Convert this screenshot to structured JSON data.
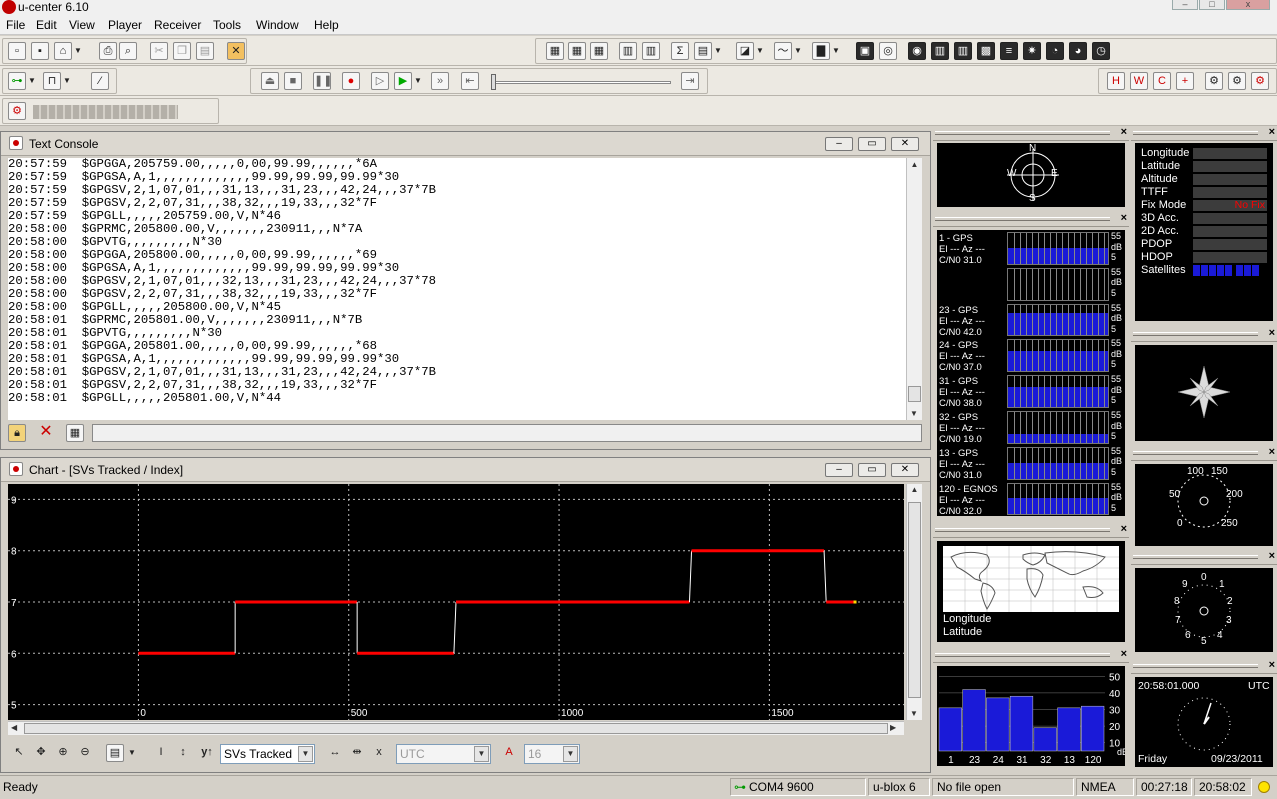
{
  "window": {
    "title": "u-center 6.10"
  },
  "menu": [
    "File",
    "Edit",
    "View",
    "Player",
    "Receiver",
    "Tools",
    "Window",
    "Help"
  ],
  "text_console": {
    "title": "Text Console",
    "lines": [
      "20:57:59  $GPGGA,205759.00,,,,,0,00,99.99,,,,,,*6A",
      "20:57:59  $GPGSA,A,1,,,,,,,,,,,,,99.99,99.99,99.99*30",
      "20:57:59  $GPGSV,2,1,07,01,,,31,13,,,31,23,,,42,24,,,37*7B",
      "20:57:59  $GPGSV,2,2,07,31,,,38,32,,,19,33,,,32*7F",
      "20:57:59  $GPGLL,,,,,205759.00,V,N*46",
      "20:58:00  $GPRMC,205800.00,V,,,,,,,230911,,,N*7A",
      "20:58:00  $GPVTG,,,,,,,,,N*30",
      "20:58:00  $GPGGA,205800.00,,,,,0,00,99.99,,,,,,*69",
      "20:58:00  $GPGSA,A,1,,,,,,,,,,,,,99.99,99.99,99.99*30",
      "20:58:00  $GPGSV,2,1,07,01,,,32,13,,,31,23,,,42,24,,,37*78",
      "20:58:00  $GPGSV,2,2,07,31,,,38,32,,,19,33,,,32*7F",
      "20:58:00  $GPGLL,,,,,205800.00,V,N*45",
      "20:58:01  $GPRMC,205801.00,V,,,,,,,230911,,,N*7B",
      "20:58:01  $GPVTG,,,,,,,,,N*30",
      "20:58:01  $GPGGA,205801.00,,,,,0,00,99.99,,,,,,*68",
      "20:58:01  $GPGSA,A,1,,,,,,,,,,,,,99.99,99.99,99.99*30",
      "20:58:01  $GPGSV,2,1,07,01,,,31,13,,,31,23,,,42,24,,,37*7B",
      "20:58:01  $GPGSV,2,2,07,31,,,38,32,,,19,33,,,32*7F",
      "20:58:01  $GPGLL,,,,,205801.00,V,N*44"
    ],
    "command_input": ""
  },
  "chart_panel": {
    "title": "Chart - [SVs Tracked / Index]",
    "series_select": "SVs Tracked",
    "time_select": "UTC",
    "size_select": "16"
  },
  "chart_data": {
    "type": "line",
    "title": "",
    "xlabel": "",
    "ylabel": "",
    "xlim": [
      -310,
      1820
    ],
    "ylim": [
      4.7,
      9.3
    ],
    "xticks": [
      0,
      500,
      1000,
      1500
    ],
    "yticks": [
      5,
      6,
      7,
      8,
      9
    ],
    "grid": true,
    "series": [
      {
        "color": "#ff0000",
        "points": [
          [
            0,
            6
          ],
          [
            230,
            6
          ],
          [
            230,
            7
          ],
          [
            520,
            7
          ],
          [
            520,
            6
          ],
          [
            750,
            6
          ],
          [
            755,
            7
          ],
          [
            1310,
            7
          ],
          [
            1315,
            8
          ],
          [
            1630,
            8
          ],
          [
            1635,
            7
          ],
          [
            1700,
            7
          ]
        ]
      }
    ],
    "end_marker_color": "#ffd700"
  },
  "sky_view": {
    "north": "N",
    "south": "S",
    "east": "E",
    "west": "W"
  },
  "satellites": [
    {
      "name": "1 - GPS",
      "el_az": "El --- Az ---",
      "cn0": "C/N0 31.0",
      "level": 31
    },
    {
      "name": "",
      "el_az": "",
      "cn0": "",
      "level": 0
    },
    {
      "name": "23 - GPS",
      "el_az": "El --- Az ---",
      "cn0": "C/N0 42.0",
      "level": 42
    },
    {
      "name": "24 - GPS",
      "el_az": "El --- Az ---",
      "cn0": "C/N0 37.0",
      "level": 37
    },
    {
      "name": "31 - GPS",
      "el_az": "El --- Az ---",
      "cn0": "C/N0 38.0",
      "level": 38
    },
    {
      "name": "32 - GPS",
      "el_az": "El --- Az ---",
      "cn0": "C/N0 19.0",
      "level": 19
    },
    {
      "name": "13 - GPS",
      "el_az": "El --- Az ---",
      "cn0": "C/N0 31.0",
      "level": 31
    },
    {
      "name": "120 - EGNOS",
      "el_az": "El --- Az ---",
      "cn0": "C/N0 32.0",
      "level": 32
    }
  ],
  "sat_scale": {
    "top": "55",
    "unit": "dB",
    "bottom": "5"
  },
  "navigation": {
    "labels": [
      "Longitude",
      "Latitude",
      "Altitude",
      "TTFF",
      "Fix Mode",
      "3D Acc.",
      "2D Acc.",
      "PDOP",
      "HDOP",
      "Satellites"
    ],
    "fix_mode_value": "No Fix"
  },
  "world_map": {
    "lon_label": "Longitude",
    "lat_label": "Latitude"
  },
  "speedometer": {
    "labels": [
      "100",
      "150",
      "50",
      "200",
      "0",
      "250"
    ]
  },
  "altimeter": {
    "labels": [
      "0",
      "9",
      "1",
      "8",
      "2",
      "7",
      "3",
      "6",
      "5",
      "4"
    ]
  },
  "cn0_histogram": {
    "bars": [
      {
        "label": "1",
        "value": 31
      },
      {
        "label": "23",
        "value": 42
      },
      {
        "label": "24",
        "value": 37
      },
      {
        "label": "31",
        "value": 38
      },
      {
        "label": "32",
        "value": 19
      },
      {
        "label": "13",
        "value": 31
      },
      {
        "label": "120",
        "value": 32
      }
    ],
    "ticks": [
      "50",
      "40",
      "30",
      "20",
      "10"
    ],
    "unit": "dB"
  },
  "clock": {
    "time": "20:58:01.000",
    "zone": "UTC",
    "day": "Friday",
    "date": "09/23/2011"
  },
  "status": {
    "ready": "Ready",
    "port": "COM4 9600",
    "receiver": "u-blox 6",
    "file": "No file open",
    "protocol": "NMEA",
    "elapsed": "00:27:18",
    "time": "20:58:02"
  },
  "colors": {
    "trace": "#ff0000",
    "signal_bar": "#1a1ad8",
    "fix_none": "#ff0000",
    "panel_bg": "#d4d0c8"
  }
}
